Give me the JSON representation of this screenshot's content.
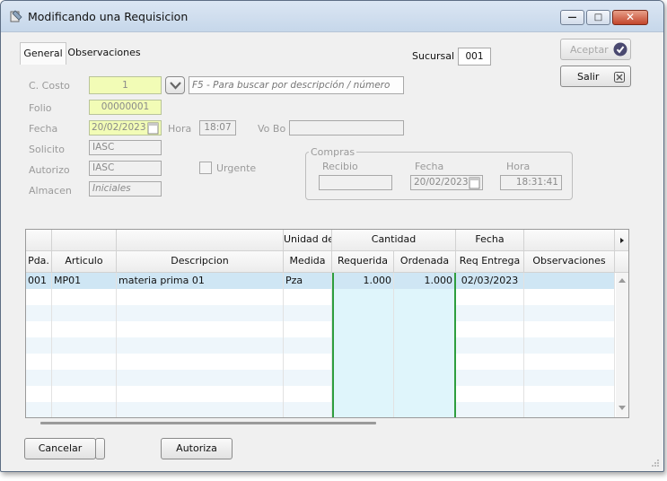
{
  "window": {
    "title": "Modificando una Requisicion",
    "icon": "requisition-app-icon"
  },
  "titlebar_buttons": {
    "minimize": "—",
    "maximize": "□",
    "close": "✕"
  },
  "tabs": [
    {
      "label": "General",
      "active": true
    },
    {
      "label": "Observaciones",
      "active": false
    }
  ],
  "sucursal": {
    "label": "Sucursal",
    "value": "001"
  },
  "actions": {
    "aceptar": "Aceptar",
    "salir": "Salir",
    "cancelar": "Cancelar",
    "autoriza": "Autoriza"
  },
  "form": {
    "c_costo": {
      "label": "C. Costo",
      "value": "1",
      "search_hint": "F5 - Para buscar por descripción / número"
    },
    "folio": {
      "label": "Folio",
      "value": "00000001"
    },
    "fecha": {
      "label": "Fecha",
      "value": "20/02/2023"
    },
    "hora": {
      "label": "Hora",
      "value": "18:07"
    },
    "vo_bo": {
      "label": "Vo Bo",
      "value": ""
    },
    "solicito": {
      "label": "Solicito",
      "value": "IASC"
    },
    "autorizo": {
      "label": "Autorizo",
      "value": "IASC"
    },
    "urgente": {
      "label": "Urgente",
      "checked": false
    },
    "almacen": {
      "label": "Almacen",
      "value": "Iniciales"
    }
  },
  "compras": {
    "label": "Compras",
    "recibio": {
      "label": "Recibio",
      "value": ""
    },
    "fecha": {
      "label": "Fecha",
      "value": "20/02/2023"
    },
    "hora": {
      "label": "Hora",
      "value": "18:31:41"
    }
  },
  "grid": {
    "header_top": {
      "unidad": "Unidad de",
      "cantidad": "Cantidad",
      "fecha": "Fecha"
    },
    "columns": [
      "Pda.",
      "Articulo",
      "Descripcion",
      "Medida",
      "Requerida",
      "Ordenada",
      "Req Entrega",
      "Observaciones"
    ],
    "rows": [
      [
        "001",
        "MP01",
        "materia prima 01",
        "Pza",
        "1.000",
        "1.000",
        "02/03/2023",
        ""
      ]
    ],
    "empty_rows": 8
  },
  "colors": {
    "highlight_row": "#cfe6f4",
    "quantity_column_bg": "#dff5fb",
    "quantity_border": "#2e9e3e",
    "alt_row": "#eef6fb"
  }
}
